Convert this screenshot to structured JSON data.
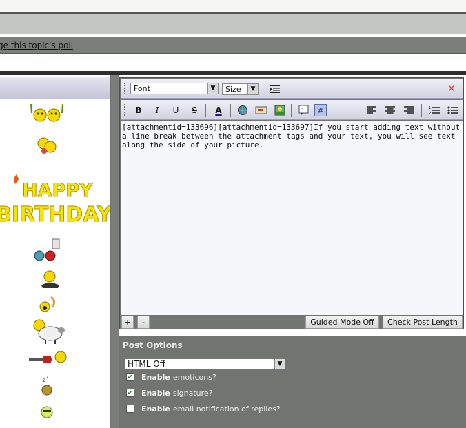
{
  "header": {
    "poll_link": "ge this topic's poll"
  },
  "smilies": {
    "items": [
      "smilie-a",
      "smilie-b",
      "happy-birthday",
      "smilie-d",
      "smilie-e",
      "smilie-f",
      "smilie-g",
      "smilie-h",
      "smilie-i",
      "smilie-j"
    ],
    "birthday_text_line1": "HAPPY",
    "birthday_text_line2": "BIRTHDAY"
  },
  "editor": {
    "font_select": "Font",
    "size_select": "Size",
    "text_content": "[attachmentid=133696][attachmentid=133697]If you start adding text without a line break between the attachment tags and your text, you will see text along the side of your picture.",
    "plus_label": "+",
    "minus_label": "-",
    "guided_mode_label": "Guided Mode Off",
    "check_length_label": "Check Post Length",
    "bold_label": "B",
    "italic_label": "I",
    "underline_label": "U",
    "strike_label": "S",
    "color_label": "A"
  },
  "post_options": {
    "title": "Post Options",
    "html_mode": "HTML Off",
    "options": [
      {
        "bold": "Enable",
        "text": "emoticons?",
        "checked": true
      },
      {
        "bold": "Enable",
        "text": "signature?",
        "checked": true
      },
      {
        "bold": "Enable",
        "text": "email notification of replies?",
        "checked": false
      }
    ]
  },
  "colors": {
    "accent_close": "#e0441a",
    "checkbox_check": "#1a8a1a",
    "toolbar_bg": "#d1d2e1",
    "panel_bg": "#727472"
  }
}
